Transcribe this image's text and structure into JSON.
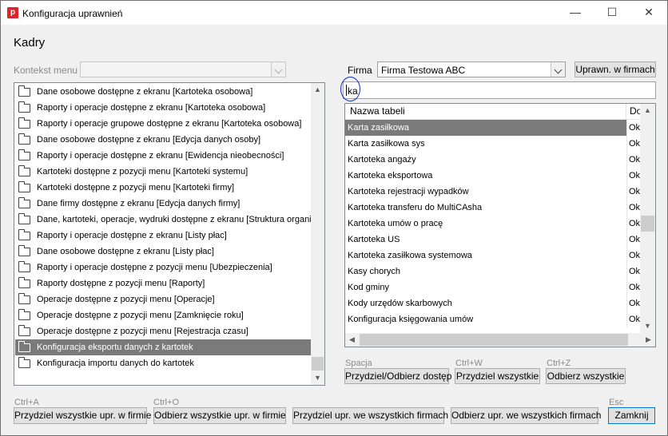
{
  "window": {
    "title": "Konfiguracja uprawnień",
    "app_icon_letter": "p"
  },
  "heading": "Kadry",
  "context_menu": {
    "label": "Kontekst menu",
    "value": ""
  },
  "firma": {
    "label": "Firma",
    "value": "Firma Testowa ABC",
    "button": "Uprawn. w firmach"
  },
  "search": {
    "value": "ka"
  },
  "left_list": {
    "items": [
      "Dane osobowe dostępne z ekranu [Kartoteka osobowa]",
      "Raporty i operacje dostępne z ekranu [Kartoteka osobowa]",
      "Raporty i operacje grupowe dostępne z ekranu [Kartoteka osobowa]",
      "Dane osobowe dostępne z ekranu [Edycja danych osoby]",
      "Raporty i operacje dostępne z ekranu [Ewidencja nieobecności]",
      "Kartoteki dostępne z pozycji menu [Kartoteki systemu]",
      "Kartoteki dostępne z pozycji menu [Kartoteki firmy]",
      "Dane firmy dostępne z ekranu [Edycja danych firmy]",
      "Dane, kartoteki, operacje, wydruki dostępne z ekranu [Struktura organiz",
      "Raporty i operacje dostępne z ekranu [Listy płac]",
      "Dane osobowe dostępne z ekranu [Listy płac]",
      "Raporty i operacje dostępne z pozycji menu [Ubezpieczenia]",
      "Raporty dostępne z pozycji menu [Raporty]",
      "Operacje dostępne z pozycji menu [Operacje]",
      "Operacje dostępne z pozycji menu [Zamknięcie roku]",
      "Operacje dostępne z pozycji menu [Rejestracja czasu]",
      "Konfiguracja eksportu danych z kartotek",
      "Konfiguracja importu danych do kartotek"
    ],
    "selected_index": 16
  },
  "grid": {
    "columns": [
      "Nazwa tabeli",
      "Do"
    ],
    "rows": [
      {
        "name": "Karta zasiłkowa",
        "access": "Ok"
      },
      {
        "name": "Karta zasiłkowa sys",
        "access": "Ok"
      },
      {
        "name": "Kartoteka angaży",
        "access": "Ok"
      },
      {
        "name": "Kartoteka eksportowa",
        "access": "Ok"
      },
      {
        "name": "Kartoteka rejestracji wypadków",
        "access": "Ok"
      },
      {
        "name": "Kartoteka transferu do MultiCAsha",
        "access": "Ok"
      },
      {
        "name": "Kartoteka umów o pracę",
        "access": "Ok"
      },
      {
        "name": "Kartoteka US",
        "access": "Ok"
      },
      {
        "name": "Kartoteka zasiłkowa systemowa",
        "access": "Ok"
      },
      {
        "name": "Kasy chorych",
        "access": "Ok"
      },
      {
        "name": "Kod gminy",
        "access": "Ok"
      },
      {
        "name": "Kody urzędów skarbowych",
        "access": "Ok"
      },
      {
        "name": "Konfiguracja księgowania umów",
        "access": "Ok"
      }
    ],
    "selected_index": 0
  },
  "grid_actions": [
    {
      "hint": "Spacja",
      "label": "Przydziel/Odbierz dostęp"
    },
    {
      "hint": "Ctrl+W",
      "label": "Przydziel wszystkie"
    },
    {
      "hint": "Ctrl+Z",
      "label": "Odbierz wszystkie"
    }
  ],
  "bottom_actions": [
    {
      "hint": "Ctrl+A",
      "label": "Przydziel wszystkie upr. w firmie"
    },
    {
      "hint": "Ctrl+O",
      "label": "Odbierz wszystkie upr. w firmie"
    },
    {
      "hint": "",
      "label": "Przydziel upr. we wszystkich firmach"
    },
    {
      "hint": "",
      "label": "Odbierz upr. we wszystkich firmach"
    }
  ],
  "close": {
    "hint": "Esc",
    "label": "Zamknij"
  }
}
